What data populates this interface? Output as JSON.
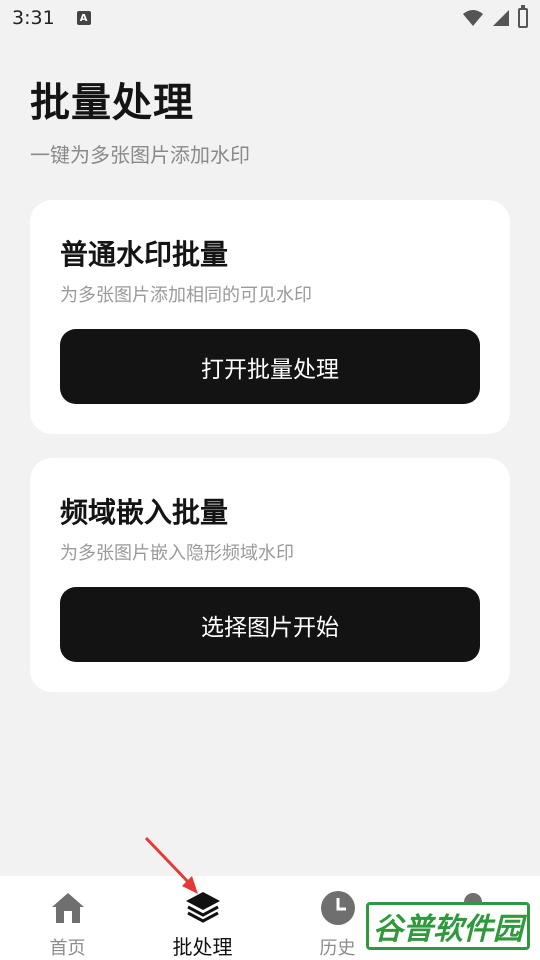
{
  "status_bar": {
    "time": "3:31",
    "notification_badge": "A"
  },
  "header": {
    "title": "批量处理",
    "subtitle": "一键为多张图片添加水印"
  },
  "cards": [
    {
      "title": "普通水印批量",
      "description": "为多张图片添加相同的可见水印",
      "button_label": "打开批量处理"
    },
    {
      "title": "频域嵌入批量",
      "description": "为多张图片嵌入隐形频域水印",
      "button_label": "选择图片开始"
    }
  ],
  "bottom_nav": {
    "items": [
      {
        "label": "首页",
        "icon": "home-icon",
        "active": false
      },
      {
        "label": "批处理",
        "icon": "layers-icon",
        "active": true
      },
      {
        "label": "历史",
        "icon": "clock-icon",
        "active": false
      },
      {
        "label": "",
        "icon": "profile-icon",
        "active": false
      }
    ]
  },
  "overlay": {
    "watermark_text": "谷普软件园"
  },
  "colors": {
    "background": "#f2f2f2",
    "card": "#ffffff",
    "button": "#131313",
    "watermark_green": "#2f9a3c",
    "arrow_red": "#e53935"
  }
}
